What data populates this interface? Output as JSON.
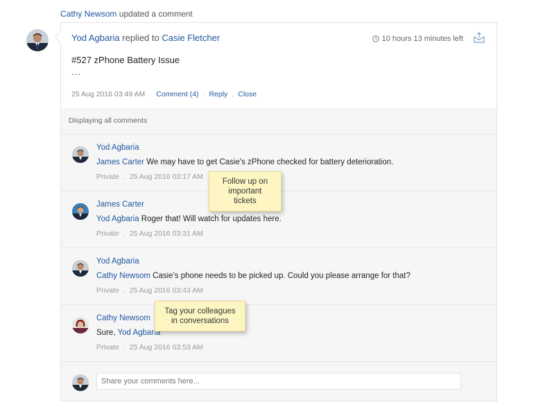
{
  "activity": {
    "actor": "Cathy Newsom",
    "action": "updated a comment"
  },
  "ticket": {
    "replier": "Yod Agbaria",
    "replied_text": "replied to",
    "recipient": "Casie Fletcher",
    "time_left": "10 hours 13 minutes left",
    "title": "#527 zPhone Battery Issue",
    "ellipsis": "...",
    "date": "25 Aug 2016 03:49 AM",
    "comment_link": "Comment (4)",
    "reply_link": "Reply",
    "close_link": "Close",
    "dot": "."
  },
  "comments": {
    "heading": "Displaying all comments",
    "items": [
      {
        "author": "Yod Agbaria",
        "mention": "James Carter",
        "text": " We may have to get Casie's zPhone checked for battery deterioration.",
        "visibility": "Private",
        "sep": ".",
        "date": "25 Aug 2016 03:17 AM"
      },
      {
        "author": "James Carter",
        "mention": "Yod Agbaria",
        "text": " Roger that! Will watch for updates here.",
        "visibility": "Private",
        "sep": ".",
        "date": "25 Aug 2016 03:31 AM"
      },
      {
        "author": "Yod Agbaria",
        "mention": "Cathy Newsom",
        "text": " Casie's phone needs to be picked up. Could you please arrange for that?",
        "visibility": "Private",
        "sep": ".",
        "date": "25 Aug 2016 03:43 AM"
      },
      {
        "author": "Cathy Newsom",
        "prefix": "Sure, ",
        "mention": "Yod Agbaria",
        "visibility": "Private",
        "sep": ".",
        "date": "25 Aug 2016 03:53 AM"
      }
    ]
  },
  "reply": {
    "placeholder": "Share your comments here..."
  },
  "tooltips": {
    "follow_line1": "Follow up on",
    "follow_line2": "important tickets",
    "tag_line1": "Tag your colleagues",
    "tag_line2": "in conversations"
  },
  "colors": {
    "link": "#1e56a0",
    "tooltip_bg": "#fdf6c3",
    "comments_bg": "#f6f6f6"
  },
  "icons": {
    "timer": "clock-icon",
    "mail": "envelope-reply-icon"
  }
}
